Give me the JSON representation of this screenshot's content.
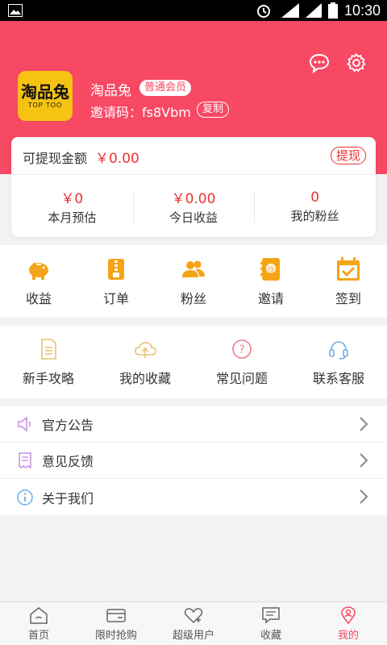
{
  "status_bar": {
    "time": "10:30",
    "network": "4G"
  },
  "header": {
    "username": "淘品兔",
    "member_badge": "普通会员",
    "invite_label": "邀请码：fs8Vbm",
    "copy_label": "复制",
    "logo_text": "淘品兔",
    "logo_sub": "TOP TOO"
  },
  "card": {
    "withdrawable_label": "可提现金额",
    "withdrawable_amount": "￥0.00",
    "withdraw_button": "提现",
    "stats": [
      {
        "value": "￥0",
        "label": "本月预估"
      },
      {
        "value": "￥0.00",
        "label": "今日收益"
      },
      {
        "value": "0",
        "label": "我的粉丝"
      }
    ]
  },
  "quick": [
    {
      "label": "收益",
      "icon": "piggy-bank-icon"
    },
    {
      "label": "订单",
      "icon": "order-icon"
    },
    {
      "label": "粉丝",
      "icon": "fans-icon"
    },
    {
      "label": "邀请",
      "icon": "invite-icon"
    },
    {
      "label": "签到",
      "icon": "checkin-icon"
    }
  ],
  "tools": [
    {
      "label": "新手攻略",
      "icon": "document-icon"
    },
    {
      "label": "我的收藏",
      "icon": "cloud-icon"
    },
    {
      "label": "常见问题",
      "icon": "question-icon"
    },
    {
      "label": "联系客服",
      "icon": "headset-icon"
    }
  ],
  "list": [
    {
      "label": "官方公告",
      "icon": "speaker-icon"
    },
    {
      "label": "意见反馈",
      "icon": "feedback-icon"
    },
    {
      "label": "关于我们",
      "icon": "info-icon"
    }
  ],
  "tabs": [
    {
      "label": "首页",
      "icon": "home-icon"
    },
    {
      "label": "限时抢购",
      "icon": "card-icon"
    },
    {
      "label": "超级用户",
      "icon": "heart-plus-icon"
    },
    {
      "label": "收藏",
      "icon": "message-icon"
    },
    {
      "label": "我的",
      "icon": "location-user-icon",
      "active": true
    }
  ],
  "colors": {
    "brand": "#f74864",
    "amount": "#e8332f",
    "accent_orange": "#f5a417"
  }
}
